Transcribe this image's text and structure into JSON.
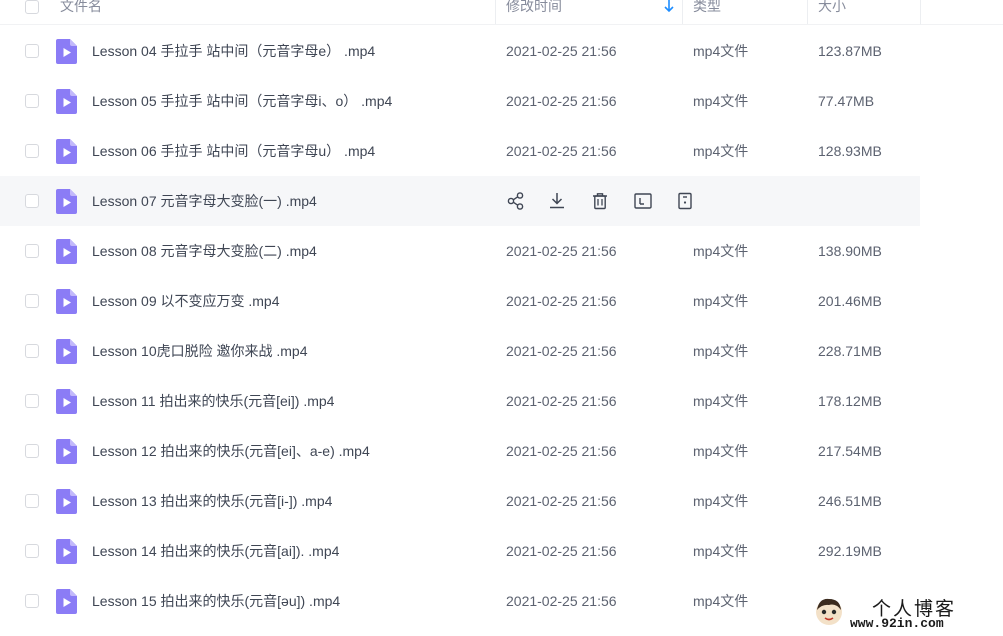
{
  "header": {
    "name_label": "文件名",
    "time_label": "修改时间",
    "type_label": "类型",
    "size_label": "大小",
    "sort_icon": "arrow-down-icon"
  },
  "colors": {
    "accent": "#1e8dff",
    "file_icon": "#8b7cf6",
    "hover_row": "#f6f7f9"
  },
  "hover_actions": [
    "share-icon",
    "download-icon",
    "delete-icon",
    "rename-icon",
    "more-icon"
  ],
  "files": [
    {
      "name": "Lesson 04 手拉手 站中间（元音字母e） .mp4",
      "time": "2021-02-25 21:56",
      "type": "mp4文件",
      "size": "123.87MB",
      "hover": false
    },
    {
      "name": "Lesson 05 手拉手 站中间（元音字母i、o） .mp4",
      "time": "2021-02-25 21:56",
      "type": "mp4文件",
      "size": "77.47MB",
      "hover": false
    },
    {
      "name": "Lesson 06 手拉手 站中间（元音字母u） .mp4",
      "time": "2021-02-25 21:56",
      "type": "mp4文件",
      "size": "128.93MB",
      "hover": false
    },
    {
      "name": "Lesson 07 元音字母大变脸(一) .mp4",
      "time": "",
      "type": "",
      "size": "",
      "hover": true
    },
    {
      "name": "Lesson 08 元音字母大变脸(二) .mp4",
      "time": "2021-02-25 21:56",
      "type": "mp4文件",
      "size": "138.90MB",
      "hover": false
    },
    {
      "name": "Lesson 09 以不变应万变 .mp4",
      "time": "2021-02-25 21:56",
      "type": "mp4文件",
      "size": "201.46MB",
      "hover": false
    },
    {
      "name": "Lesson 10虎口脱险 邀你来战 .mp4",
      "time": "2021-02-25 21:56",
      "type": "mp4文件",
      "size": "228.71MB",
      "hover": false
    },
    {
      "name": "Lesson 11 拍出来的快乐(元音[ei]) .mp4",
      "time": "2021-02-25 21:56",
      "type": "mp4文件",
      "size": "178.12MB",
      "hover": false
    },
    {
      "name": "Lesson 12 拍出来的快乐(元音[ei]、a-e) .mp4",
      "time": "2021-02-25 21:56",
      "type": "mp4文件",
      "size": "217.54MB",
      "hover": false
    },
    {
      "name": "Lesson 13 拍出来的快乐(元音[i-]) .mp4",
      "time": "2021-02-25 21:56",
      "type": "mp4文件",
      "size": "246.51MB",
      "hover": false
    },
    {
      "name": "Lesson 14 拍出来的快乐(元音[ai]). .mp4",
      "time": "2021-02-25 21:56",
      "type": "mp4文件",
      "size": "292.19MB",
      "hover": false
    },
    {
      "name": "Lesson 15 拍出来的快乐(元音[əu]) .mp4",
      "time": "2021-02-25 21:56",
      "type": "mp4文件",
      "size": "",
      "hover": false
    }
  ],
  "watermark": {
    "title": "个人博客",
    "url": "www.92in.com"
  }
}
